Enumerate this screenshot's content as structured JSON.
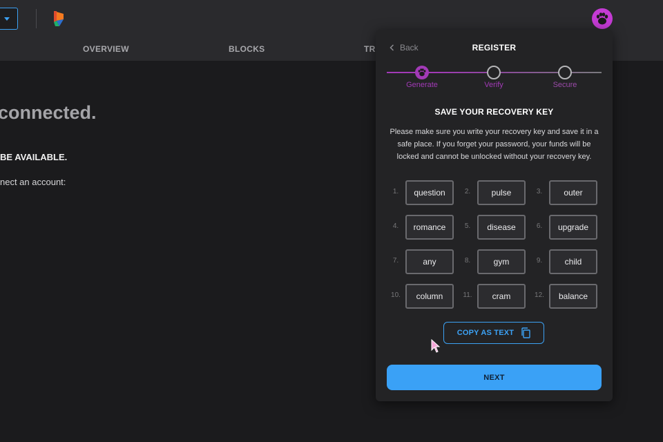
{
  "header": {
    "nav": [
      {
        "label": "OVERVIEW"
      },
      {
        "label": "BLOCKS"
      },
      {
        "label": "TRA"
      }
    ],
    "icons": {
      "dropdown": "chevron-down-icon",
      "logo": "brand-logo",
      "avatar": "paw-icon"
    },
    "colors": {
      "accent": "#3ca2f5",
      "avatar": "#c43bd4"
    }
  },
  "background": {
    "heading": "connected.",
    "subheading": "BE AVAILABLE.",
    "text": "nect an account:"
  },
  "register": {
    "back_label": "Back",
    "title": "REGISTER",
    "steps": [
      {
        "label": "Generate",
        "state": "active"
      },
      {
        "label": "Verify",
        "state": "pending"
      },
      {
        "label": "Secure",
        "state": "pending"
      }
    ],
    "section_title": "SAVE YOUR RECOVERY KEY",
    "description": "Please make sure you write your recovery key and save it in a safe place. If you forget your password, your funds will be locked and cannot be unlocked without your recovery key.",
    "words": [
      {
        "num": "1.",
        "word": "question"
      },
      {
        "num": "2.",
        "word": "pulse"
      },
      {
        "num": "3.",
        "word": "outer"
      },
      {
        "num": "4.",
        "word": "romance"
      },
      {
        "num": "5.",
        "word": "disease"
      },
      {
        "num": "6.",
        "word": "upgrade"
      },
      {
        "num": "7.",
        "word": "any"
      },
      {
        "num": "8.",
        "word": "gym"
      },
      {
        "num": "9.",
        "word": "child"
      },
      {
        "num": "10.",
        "word": "column"
      },
      {
        "num": "11.",
        "word": "cram"
      },
      {
        "num": "12.",
        "word": "balance"
      }
    ],
    "copy_label": "COPY AS TEXT",
    "next_label": "NEXT",
    "colors": {
      "step_active": "#a23ab7",
      "step_pending": "#b5b5b8",
      "primary": "#3aa1f6"
    }
  }
}
